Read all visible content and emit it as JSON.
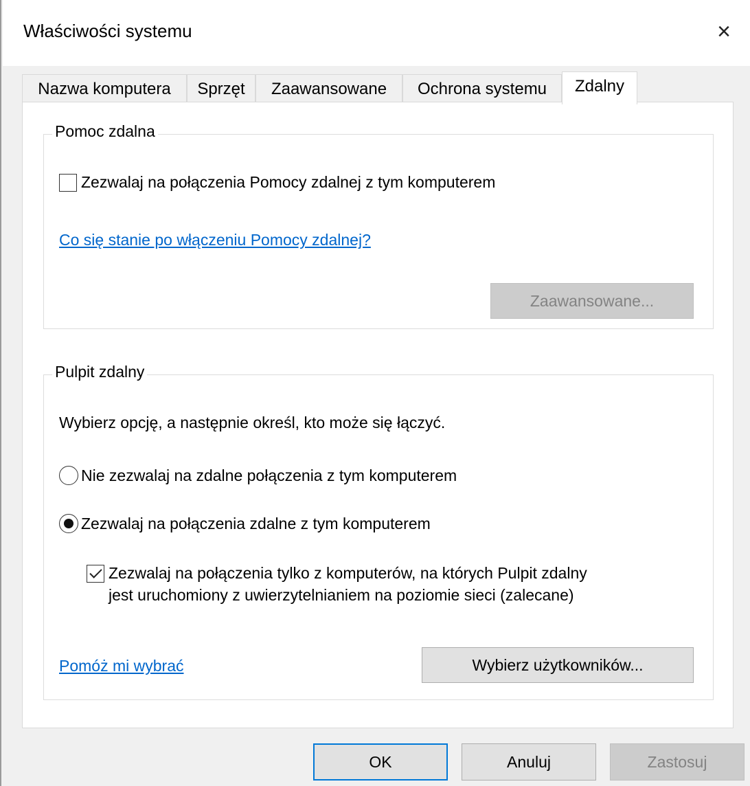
{
  "window": {
    "title": "Właściwości systemu",
    "close_icon": "×"
  },
  "tabs": [
    {
      "label": "Nazwa komputera",
      "active": false
    },
    {
      "label": "Sprzęt",
      "active": false
    },
    {
      "label": "Zaawansowane",
      "active": false
    },
    {
      "label": "Ochrona systemu",
      "active": false
    },
    {
      "label": "Zdalny",
      "active": true
    }
  ],
  "remote_assistance": {
    "legend": "Pomoc zdalna",
    "allow_checkbox_label": "Zezwalaj na połączenia Pomocy zdalnej z tym komputerem",
    "allow_checked": false,
    "help_link": "Co się stanie po włączeniu Pomocy zdalnej?",
    "advanced_button": "Zaawansowane..."
  },
  "remote_desktop": {
    "legend": "Pulpit zdalny",
    "instruction": "Wybierz opcję, a następnie określ, kto może się łączyć.",
    "option_deny": "Nie zezwalaj na zdalne połączenia z tym komputerem",
    "option_allow": "Zezwalaj na połączenia zdalne z tym komputerem",
    "selected_option": "allow",
    "nla_line1": "Zezwalaj na połączenia tylko z komputerów, na których Pulpit zdalny",
    "nla_line2": "jest uruchomiony z uwierzytelnianiem na poziomie sieci (zalecane)",
    "nla_checked": true,
    "help_link": "Pomóż mi wybrać",
    "select_users_button": "Wybierz użytkowników..."
  },
  "footer": {
    "ok": "OK",
    "cancel": "Anuluj",
    "apply": "Zastosuj"
  },
  "colors": {
    "link": "#0066cc",
    "default_button_border": "#0078d7",
    "disabled_text": "#838383"
  }
}
